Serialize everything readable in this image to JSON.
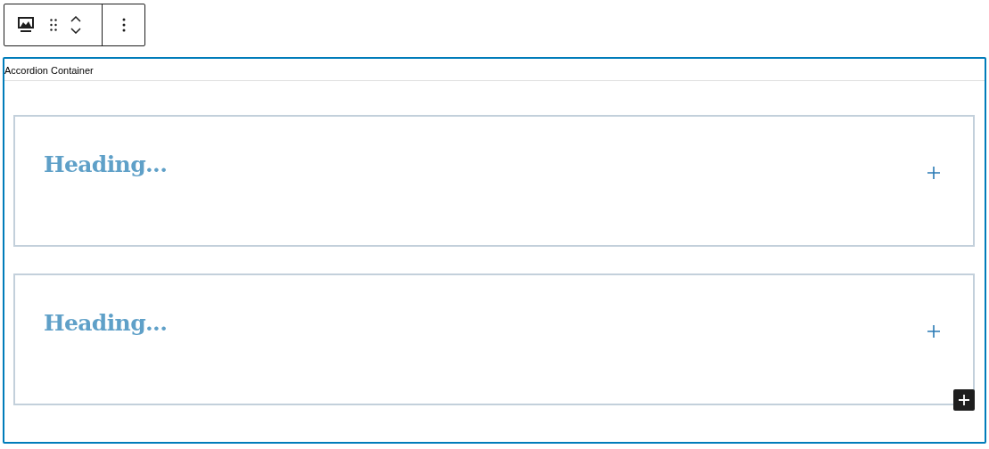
{
  "block_label": "Accordion Container",
  "items": [
    {
      "heading": "Heading..."
    },
    {
      "heading": "Heading..."
    }
  ]
}
